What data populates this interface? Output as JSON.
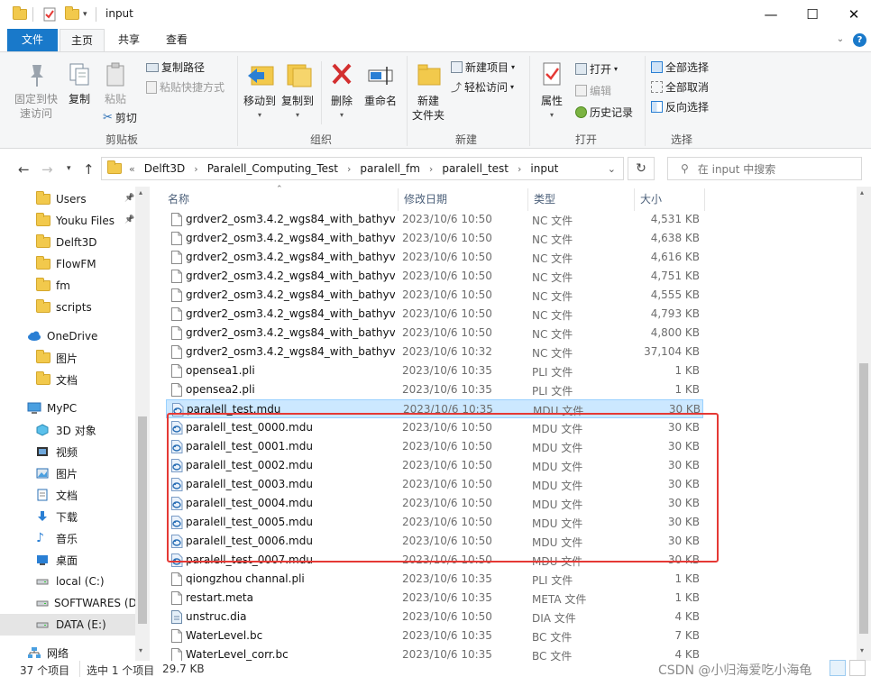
{
  "window": {
    "title": "input",
    "minimize": "—",
    "maximize": "☐",
    "close": "✕"
  },
  "tabs": [
    "文件",
    "主页",
    "共享",
    "查看"
  ],
  "ribbon": {
    "clipboard": {
      "label": "剪贴板",
      "pin": "固定到快\n速访问",
      "copy": "复制",
      "paste": "粘贴",
      "copy_path": "复制路径",
      "paste_shortcut": "粘贴快捷方式",
      "cut": "剪切"
    },
    "organize": {
      "label": "组织",
      "move_to": "移动到",
      "copy_to": "复制到",
      "delete": "删除",
      "rename": "重命名"
    },
    "new": {
      "label": "新建",
      "new_folder": "新建\n文件夹",
      "new_item": "新建项目",
      "easy_access": "轻松访问"
    },
    "open": {
      "label": "打开",
      "properties": "属性",
      "open": "打开",
      "edit": "编辑",
      "history": "历史记录"
    },
    "select": {
      "label": "选择",
      "select_all": "全部选择",
      "select_none": "全部取消",
      "invert": "反向选择"
    }
  },
  "address": {
    "breadcrumb": [
      "«",
      "Delft3D",
      "Paralell_Computing_Test",
      "paralell_fm",
      "paralell_test",
      "input"
    ],
    "search_placeholder": "在 input 中搜索"
  },
  "nav": {
    "items": [
      {
        "label": "Users",
        "icon": "folder-icon",
        "pinned": true
      },
      {
        "label": "Youku Files",
        "icon": "folder-icon",
        "pinned": true
      },
      {
        "label": "Delft3D",
        "icon": "folder-icon"
      },
      {
        "label": "FlowFM",
        "icon": "folder-icon"
      },
      {
        "label": "fm",
        "icon": "folder-icon"
      },
      {
        "label": "scripts",
        "icon": "folder-icon"
      },
      {
        "label": "OneDrive",
        "icon": "cloud-icon"
      },
      {
        "label": "图片",
        "icon": "folder-icon"
      },
      {
        "label": "文档",
        "icon": "folder-icon"
      },
      {
        "label": "MyPC",
        "icon": "computer-icon"
      },
      {
        "label": "3D 对象",
        "icon": "cube-icon"
      },
      {
        "label": "视频",
        "icon": "video-icon"
      },
      {
        "label": "图片",
        "icon": "pictures-icon"
      },
      {
        "label": "文档",
        "icon": "documents-icon"
      },
      {
        "label": "下载",
        "icon": "download-icon"
      },
      {
        "label": "音乐",
        "icon": "music-icon"
      },
      {
        "label": "桌面",
        "icon": "desktop-icon"
      },
      {
        "label": "local (C:)",
        "icon": "drive-icon"
      },
      {
        "label": "SOFTWARES (D",
        "icon": "drive-icon"
      },
      {
        "label": "DATA (E:)",
        "icon": "drive-icon",
        "selected": true
      },
      {
        "label": "网络",
        "icon": "network-icon"
      }
    ]
  },
  "columns": {
    "name": "名称",
    "date": "修改日期",
    "type": "类型",
    "size": "大小"
  },
  "files": [
    {
      "name": "grdver2_osm3.4.2_wgs84_with_bathyv...",
      "date": "2023/10/6 10:50",
      "type": "NC 文件",
      "size": "4,531 KB",
      "icon": "file-icon"
    },
    {
      "name": "grdver2_osm3.4.2_wgs84_with_bathyv...",
      "date": "2023/10/6 10:50",
      "type": "NC 文件",
      "size": "4,638 KB",
      "icon": "file-icon"
    },
    {
      "name": "grdver2_osm3.4.2_wgs84_with_bathyv...",
      "date": "2023/10/6 10:50",
      "type": "NC 文件",
      "size": "4,616 KB",
      "icon": "file-icon"
    },
    {
      "name": "grdver2_osm3.4.2_wgs84_with_bathyv...",
      "date": "2023/10/6 10:50",
      "type": "NC 文件",
      "size": "4,751 KB",
      "icon": "file-icon"
    },
    {
      "name": "grdver2_osm3.4.2_wgs84_with_bathyv...",
      "date": "2023/10/6 10:50",
      "type": "NC 文件",
      "size": "4,555 KB",
      "icon": "file-icon"
    },
    {
      "name": "grdver2_osm3.4.2_wgs84_with_bathyv...",
      "date": "2023/10/6 10:50",
      "type": "NC 文件",
      "size": "4,793 KB",
      "icon": "file-icon"
    },
    {
      "name": "grdver2_osm3.4.2_wgs84_with_bathyv...",
      "date": "2023/10/6 10:50",
      "type": "NC 文件",
      "size": "4,800 KB",
      "icon": "file-icon"
    },
    {
      "name": "grdver2_osm3.4.2_wgs84_with_bathyv...",
      "date": "2023/10/6 10:32",
      "type": "NC 文件",
      "size": "37,104 KB",
      "icon": "file-icon"
    },
    {
      "name": "opensea1.pli",
      "date": "2023/10/6 10:35",
      "type": "PLI 文件",
      "size": "1 KB",
      "icon": "file-icon"
    },
    {
      "name": "opensea2.pli",
      "date": "2023/10/6 10:35",
      "type": "PLI 文件",
      "size": "1 KB",
      "icon": "file-icon"
    },
    {
      "name": "paralell_test.mdu",
      "date": "2023/10/6 10:35",
      "type": "MDU 文件",
      "size": "30 KB",
      "icon": "mdu-icon",
      "selected": true
    },
    {
      "name": "paralell_test_0000.mdu",
      "date": "2023/10/6 10:50",
      "type": "MDU 文件",
      "size": "30 KB",
      "icon": "mdu-icon"
    },
    {
      "name": "paralell_test_0001.mdu",
      "date": "2023/10/6 10:50",
      "type": "MDU 文件",
      "size": "30 KB",
      "icon": "mdu-icon"
    },
    {
      "name": "paralell_test_0002.mdu",
      "date": "2023/10/6 10:50",
      "type": "MDU 文件",
      "size": "30 KB",
      "icon": "mdu-icon"
    },
    {
      "name": "paralell_test_0003.mdu",
      "date": "2023/10/6 10:50",
      "type": "MDU 文件",
      "size": "30 KB",
      "icon": "mdu-icon"
    },
    {
      "name": "paralell_test_0004.mdu",
      "date": "2023/10/6 10:50",
      "type": "MDU 文件",
      "size": "30 KB",
      "icon": "mdu-icon"
    },
    {
      "name": "paralell_test_0005.mdu",
      "date": "2023/10/6 10:50",
      "type": "MDU 文件",
      "size": "30 KB",
      "icon": "mdu-icon"
    },
    {
      "name": "paralell_test_0006.mdu",
      "date": "2023/10/6 10:50",
      "type": "MDU 文件",
      "size": "30 KB",
      "icon": "mdu-icon"
    },
    {
      "name": "paralell_test_0007.mdu",
      "date": "2023/10/6 10:50",
      "type": "MDU 文件",
      "size": "30 KB",
      "icon": "mdu-icon"
    },
    {
      "name": "qiongzhou channal.pli",
      "date": "2023/10/6 10:35",
      "type": "PLI 文件",
      "size": "1 KB",
      "icon": "file-icon"
    },
    {
      "name": "restart.meta",
      "date": "2023/10/6 10:35",
      "type": "META 文件",
      "size": "1 KB",
      "icon": "file-icon"
    },
    {
      "name": "unstruc.dia",
      "date": "2023/10/6 10:50",
      "type": "DIA 文件",
      "size": "4 KB",
      "icon": "dia-icon"
    },
    {
      "name": "WaterLevel.bc",
      "date": "2023/10/6 10:35",
      "type": "BC 文件",
      "size": "7 KB",
      "icon": "file-icon"
    },
    {
      "name": "WaterLevel_corr.bc",
      "date": "2023/10/6 10:35",
      "type": "BC 文件",
      "size": "4 KB",
      "icon": "file-icon"
    }
  ],
  "status": {
    "count": "37 个项目",
    "selected": "选中 1 个项目",
    "size": "29.7 KB"
  },
  "watermark": "CSDN @小归海爱吃小海龟",
  "colors": {
    "accent": "#1979ca",
    "selection": "#cce8ff",
    "highlight_box": "#e53935"
  }
}
